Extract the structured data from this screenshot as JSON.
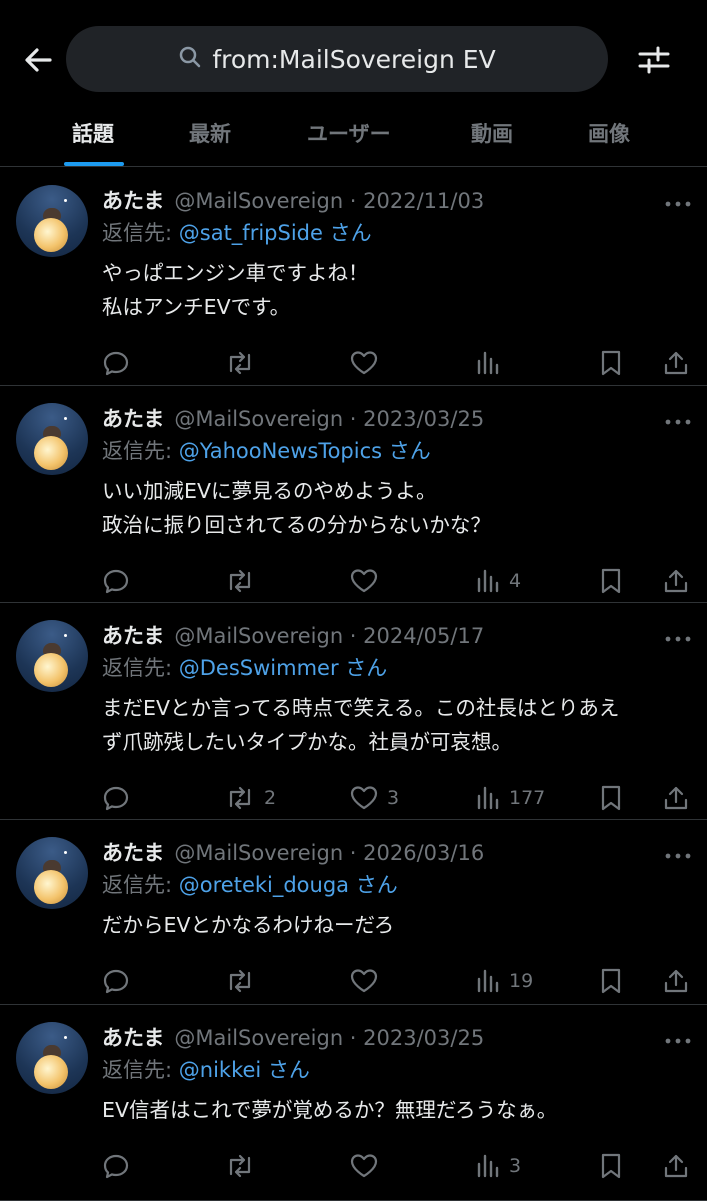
{
  "header": {
    "search_query": "from:MailSovereign EV",
    "back_icon": "arrow-left-icon",
    "filter_icon": "sliders-icon"
  },
  "tabs": [
    {
      "label": "話題",
      "active": true
    },
    {
      "label": "最新",
      "active": false
    },
    {
      "label": "ユーザー",
      "active": false
    },
    {
      "label": "動画",
      "active": false
    },
    {
      "label": "画像",
      "active": false
    }
  ],
  "colors": {
    "accent": "#1d9bf0",
    "mention": "#4ea2e8",
    "muted": "#71767b",
    "text": "#e7e9ea"
  },
  "tweets": [
    {
      "name": "あたま",
      "handle_date": "@MailSovereign · 2022/11/03",
      "reply_prefix": "返信先: ",
      "reply_to": "@sat_fripSide",
      "reply_suffix": " さん",
      "lines": [
        "やっぱエンジン車ですよね！",
        "私はアンチEVです。"
      ],
      "retweets": "",
      "likes": "",
      "views": ""
    },
    {
      "name": "あたま",
      "handle_date": "@MailSovereign · 2023/03/25",
      "reply_prefix": "返信先: ",
      "reply_to": "@YahooNewsTopics",
      "reply_suffix": " さん",
      "lines": [
        "いい加減EVに夢見るのやめようよ。",
        "政治に振り回されてるの分からないかな？"
      ],
      "retweets": "",
      "likes": "",
      "views": "4"
    },
    {
      "name": "あたま",
      "handle_date": "@MailSovereign · 2024/05/17",
      "reply_prefix": "返信先: ",
      "reply_to": "@DesSwimmer",
      "reply_suffix": " さん",
      "lines": [
        "まだEVとか言ってる時点で笑える。この社長はとりあえ",
        "ず爪跡残したいタイプかな。社員が可哀想。"
      ],
      "retweets": "2",
      "likes": "3",
      "views": "177"
    },
    {
      "name": "あたま",
      "handle_date": "@MailSovereign · 2026/03/16",
      "reply_prefix": "返信先: ",
      "reply_to": "@oreteki_douga",
      "reply_suffix": " さん",
      "lines": [
        "だからEVとかなるわけねーだろ"
      ],
      "retweets": "",
      "likes": "",
      "views": "19"
    },
    {
      "name": "あたま",
      "handle_date": "@MailSovereign · 2023/03/25",
      "reply_prefix": "返信先: ",
      "reply_to": "@nikkei",
      "reply_suffix": " さん",
      "lines": [
        "EV信者はこれで夢が覚めるか？無理だろうなぁ。"
      ],
      "retweets": "",
      "likes": "",
      "views": "3"
    }
  ]
}
